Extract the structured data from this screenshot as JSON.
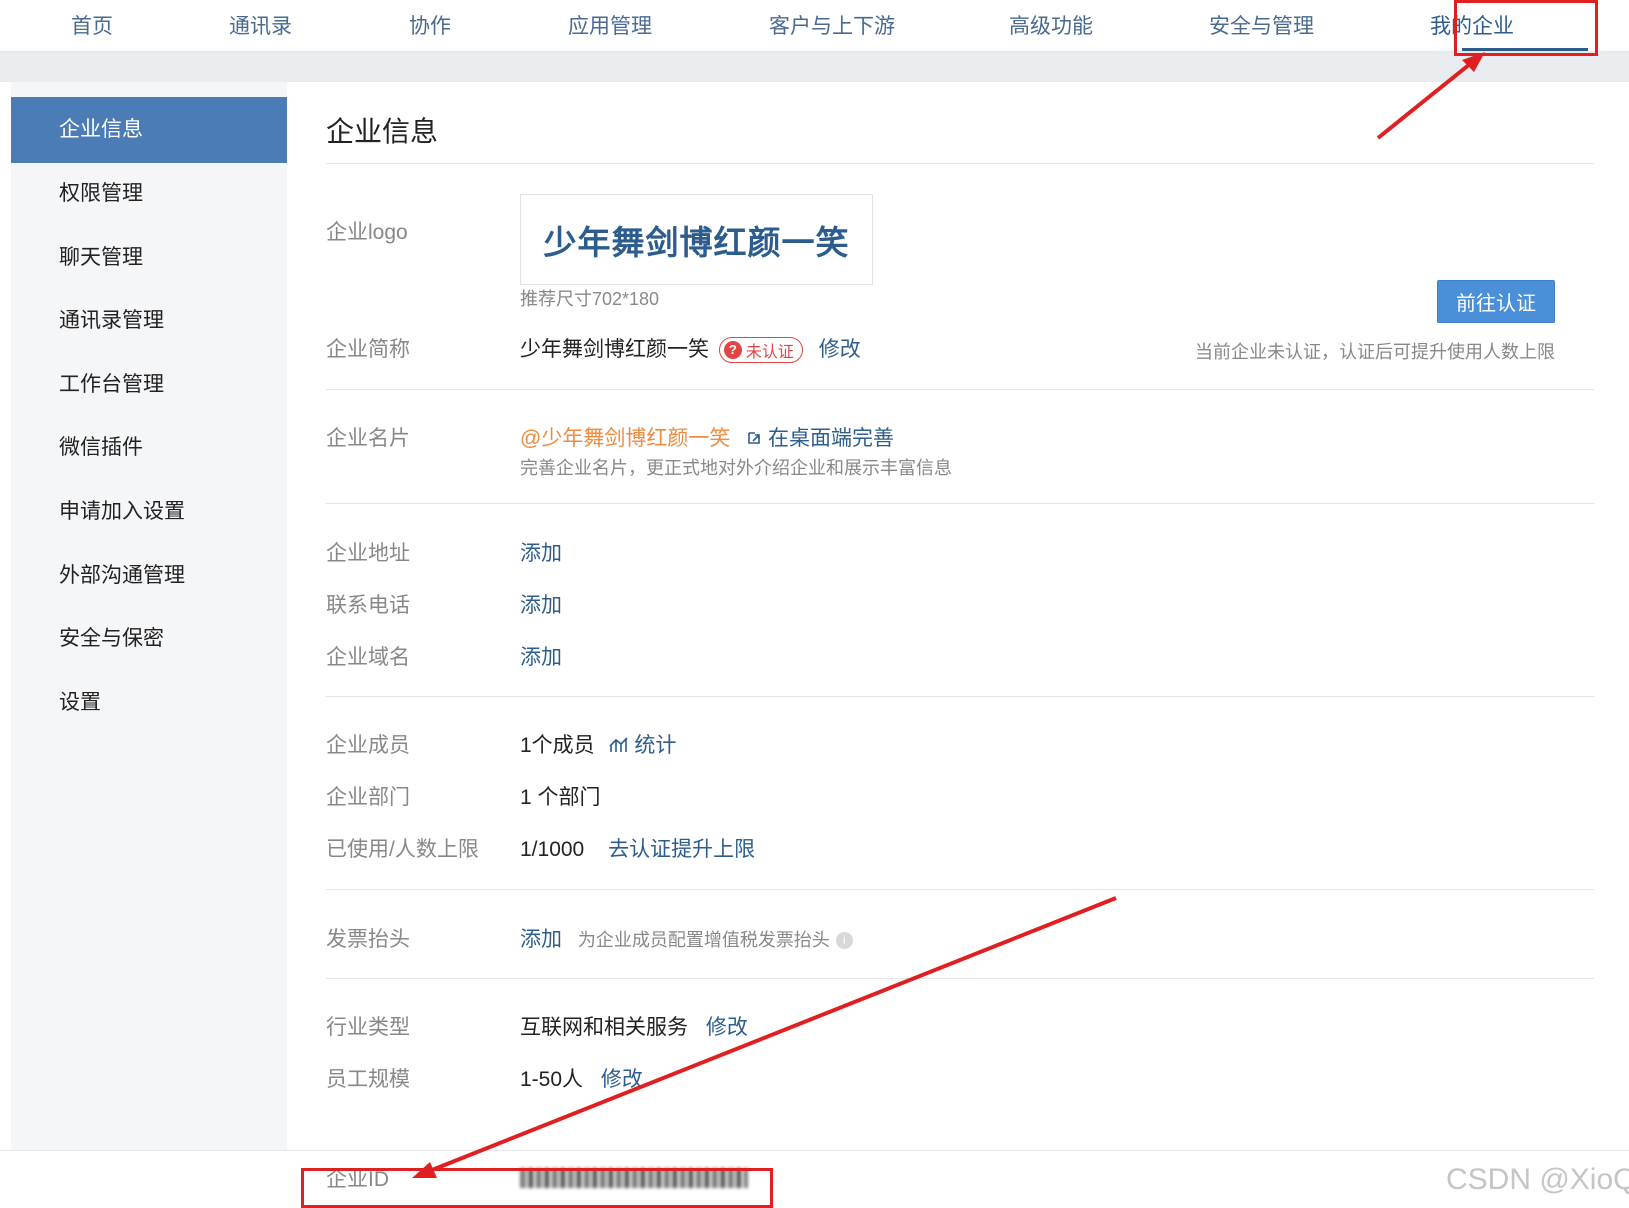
{
  "topnav": {
    "tabs": [
      {
        "label": "首页"
      },
      {
        "label": "通讯录"
      },
      {
        "label": "协作"
      },
      {
        "label": "应用管理"
      },
      {
        "label": "客户与上下游"
      },
      {
        "label": "高级功能"
      },
      {
        "label": "安全与管理"
      },
      {
        "label": "我的企业",
        "active": true
      }
    ]
  },
  "sidebar": {
    "items": [
      {
        "label": "企业信息",
        "active": true
      },
      {
        "label": "权限管理"
      },
      {
        "label": "聊天管理"
      },
      {
        "label": "通讯录管理"
      },
      {
        "label": "工作台管理"
      },
      {
        "label": "微信插件"
      },
      {
        "label": "申请加入设置"
      },
      {
        "label": "外部沟通管理"
      },
      {
        "label": "安全与保密"
      },
      {
        "label": "设置"
      }
    ]
  },
  "main": {
    "title": "企业信息",
    "logo": {
      "label": "企业logo",
      "text": "少年舞剑博红颜一笑",
      "hint": "推荐尺寸702*180"
    },
    "short_name": {
      "label": "企业简称",
      "value": "少年舞剑博红颜一笑",
      "badge": "未认证",
      "edit": "修改"
    },
    "verify": {
      "button": "前往认证",
      "hint": "当前企业未认证，认证后可提升使用人数上限"
    },
    "card": {
      "label": "企业名片",
      "value": "@少年舞剑博红颜一笑",
      "link": "在桌面端完善",
      "hint": "完善企业名片，更正式地对外介绍企业和展示丰富信息"
    },
    "address": {
      "label": "企业地址",
      "action": "添加"
    },
    "phone": {
      "label": "联系电话",
      "action": "添加"
    },
    "domain": {
      "label": "企业域名",
      "action": "添加"
    },
    "members": {
      "label": "企业成员",
      "value": "1个成员",
      "link": "统计"
    },
    "departments": {
      "label": "企业部门",
      "value": "1 个部门"
    },
    "usage": {
      "label": "已使用/人数上限",
      "value": "1/1000",
      "link": "去认证提升上限"
    },
    "invoice": {
      "label": "发票抬头",
      "action": "添加",
      "hint": "为企业成员配置增值税发票抬头"
    },
    "industry": {
      "label": "行业类型",
      "value": "互联网和相关服务",
      "edit": "修改"
    },
    "scale": {
      "label": "员工规模",
      "value": "1-50人",
      "edit": "修改"
    },
    "corp_id": {
      "label": "企业ID"
    }
  },
  "watermark": "CSDN @XioQ",
  "colors": {
    "accent": "#2d5d8e",
    "sidebar_active": "#4b7cb5",
    "verify_button": "#4a90d9",
    "badge_red": "#e04646",
    "annotation_red": "#e02020",
    "orange": "#f08a3c"
  },
  "icons": [
    "external-link-icon",
    "stats-chart-icon",
    "info-icon",
    "question-icon"
  ]
}
